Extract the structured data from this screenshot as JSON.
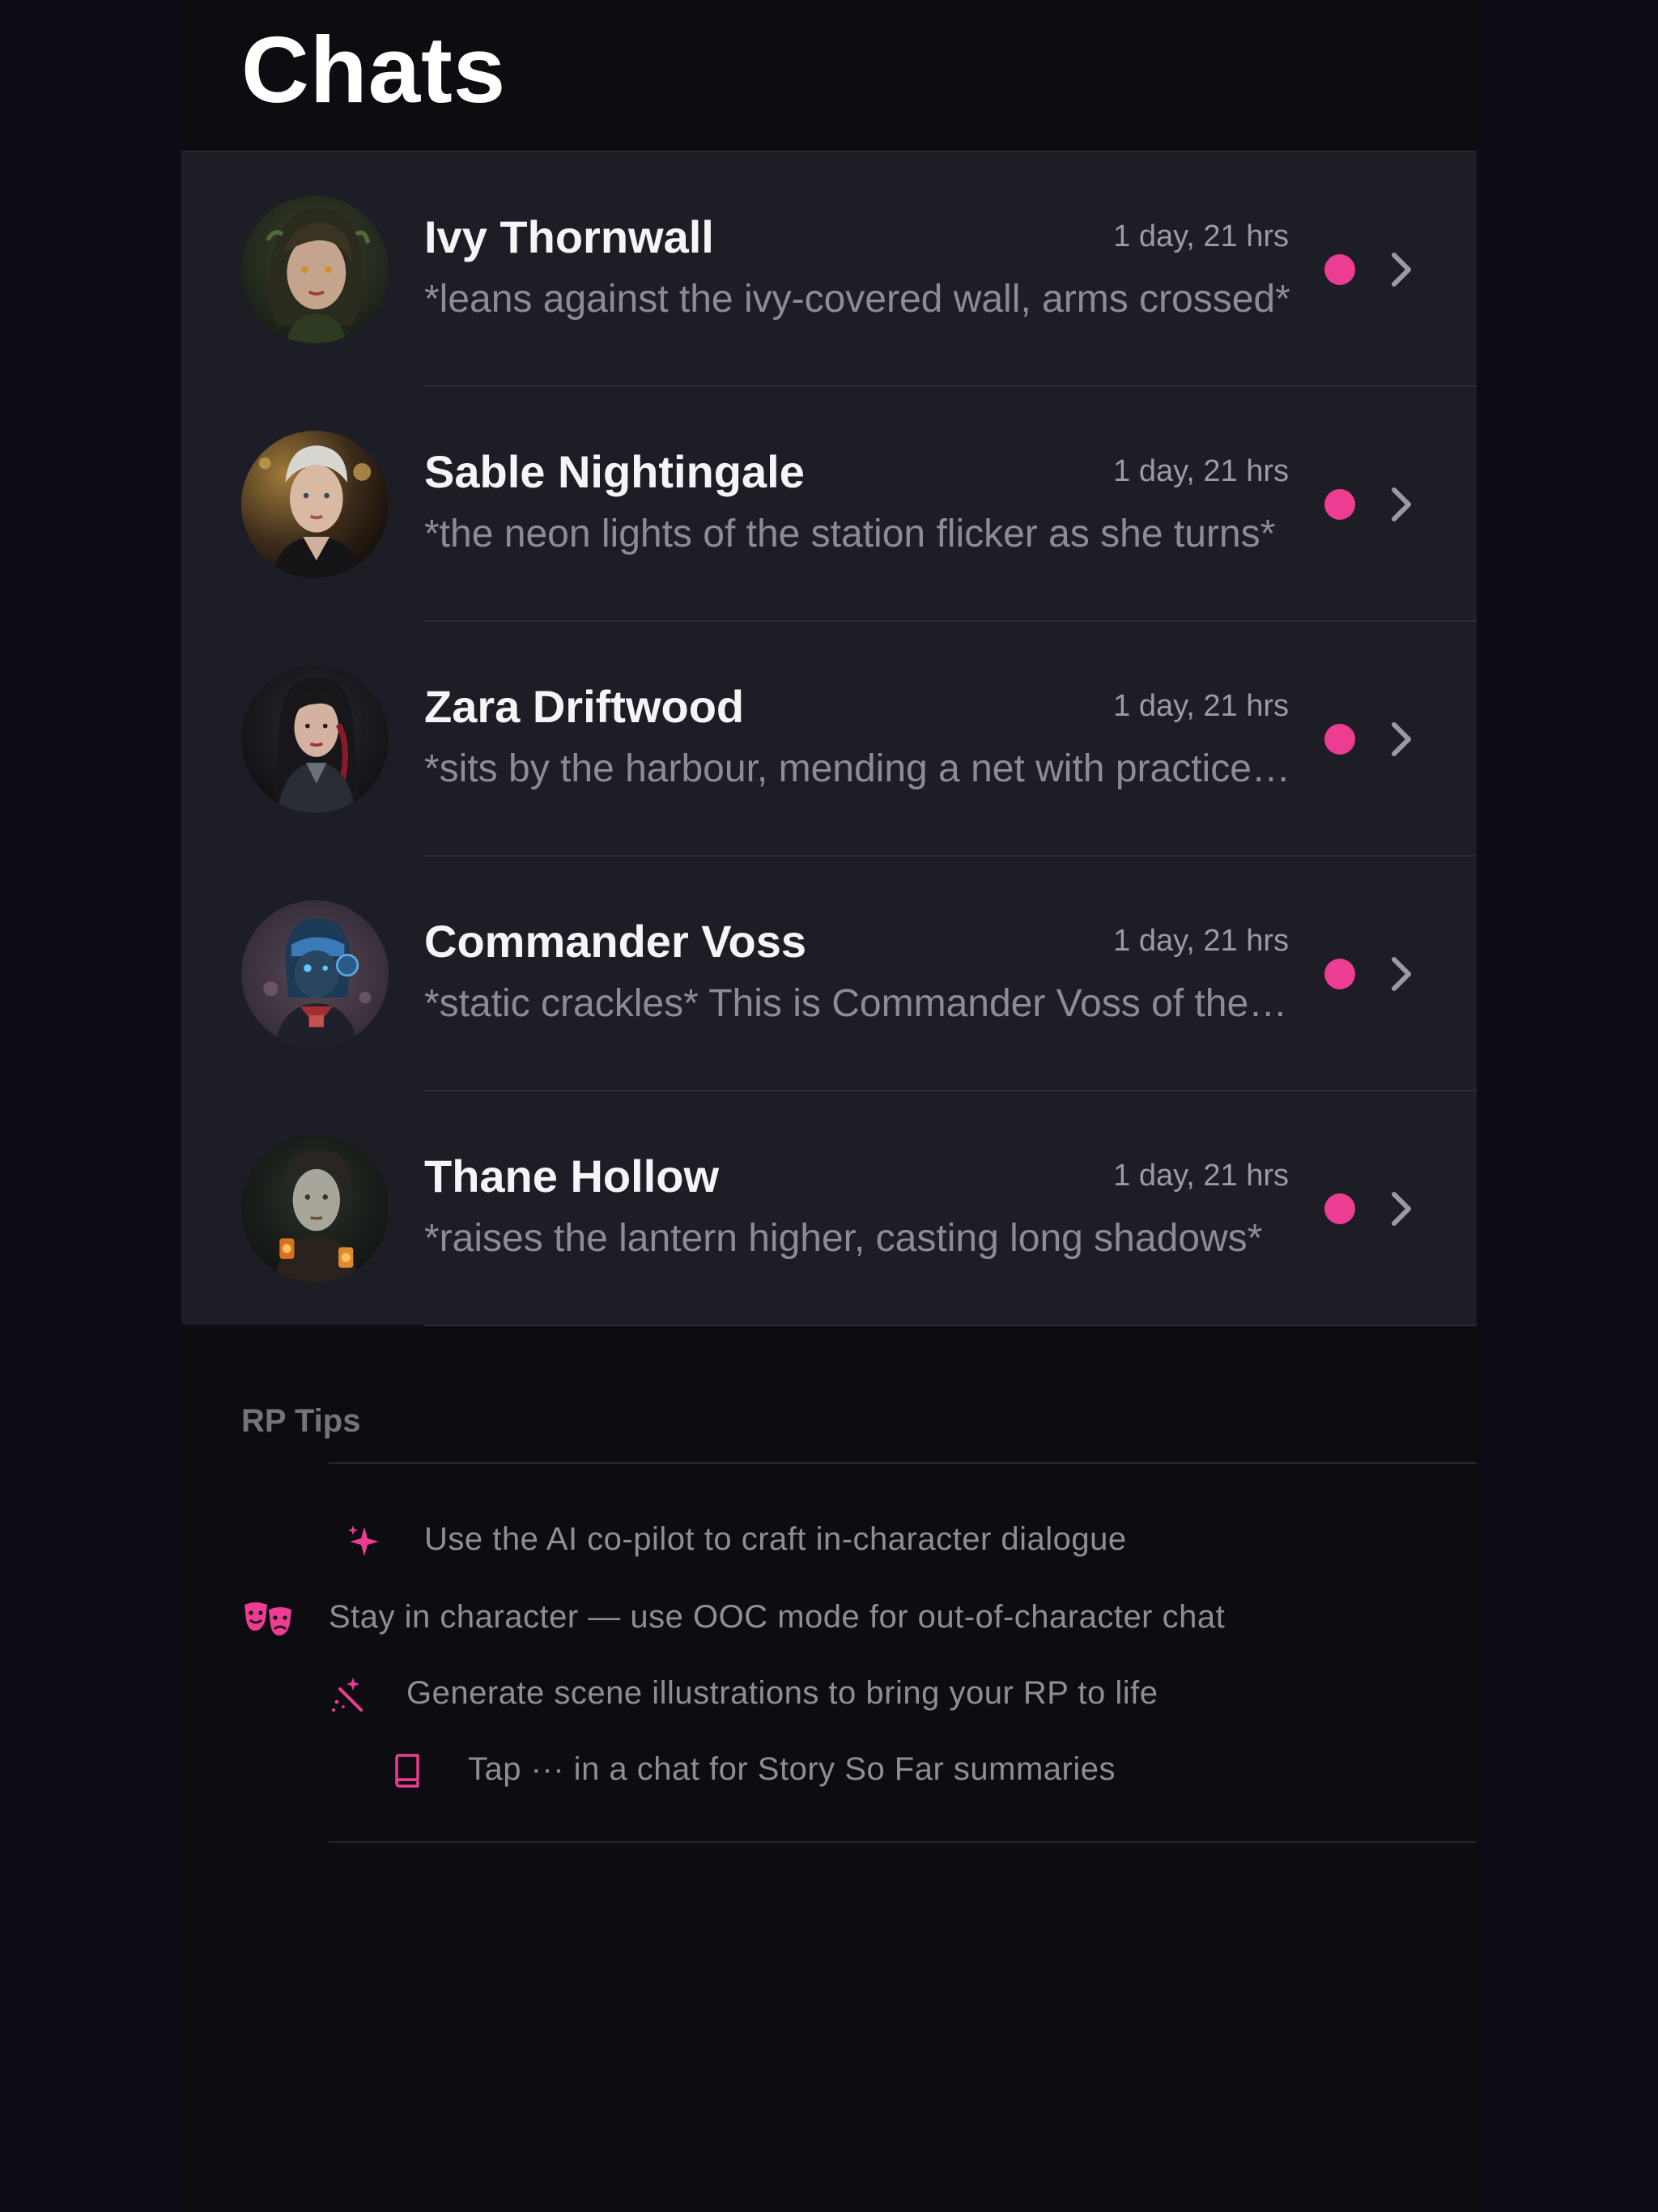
{
  "header": {
    "title": "Chats"
  },
  "chats": [
    {
      "name": "Ivy Thornwall",
      "time": "1 day, 21 hrs",
      "preview": "*leans against the ivy-covered wall, arms crossed*"
    },
    {
      "name": "Sable Nightingale",
      "time": "1 day, 21 hrs",
      "preview": "*the neon lights of the station flicker as she turns*"
    },
    {
      "name": "Zara Driftwood",
      "time": "1 day, 21 hrs",
      "preview": "*sits by the harbour, mending a net with practiced hands*"
    },
    {
      "name": "Commander Voss",
      "time": "1 day, 21 hrs",
      "preview": "*static crackles* This is Commander Voss of the fleet"
    },
    {
      "name": "Thane Hollow",
      "time": "1 day, 21 hrs",
      "preview": "*raises the lantern higher, casting long shadows*"
    }
  ],
  "tips": {
    "title": "RP Tips",
    "items": [
      {
        "icon": "sparkles-icon",
        "text": "Use the AI co-pilot to craft in-character dialogue"
      },
      {
        "icon": "theater-masks-icon",
        "text": "Stay in character — use OOC mode for out-of-character chat"
      },
      {
        "icon": "magic-wand-icon",
        "text": "Generate scene illustrations to bring your RP to life"
      },
      {
        "icon": "book-icon",
        "text": "Tap ··· in a chat for Story So Far summaries"
      }
    ]
  },
  "colors": {
    "accent": "#ec3d93",
    "background": "#0c0c11",
    "list_background": "#1d1d26"
  }
}
